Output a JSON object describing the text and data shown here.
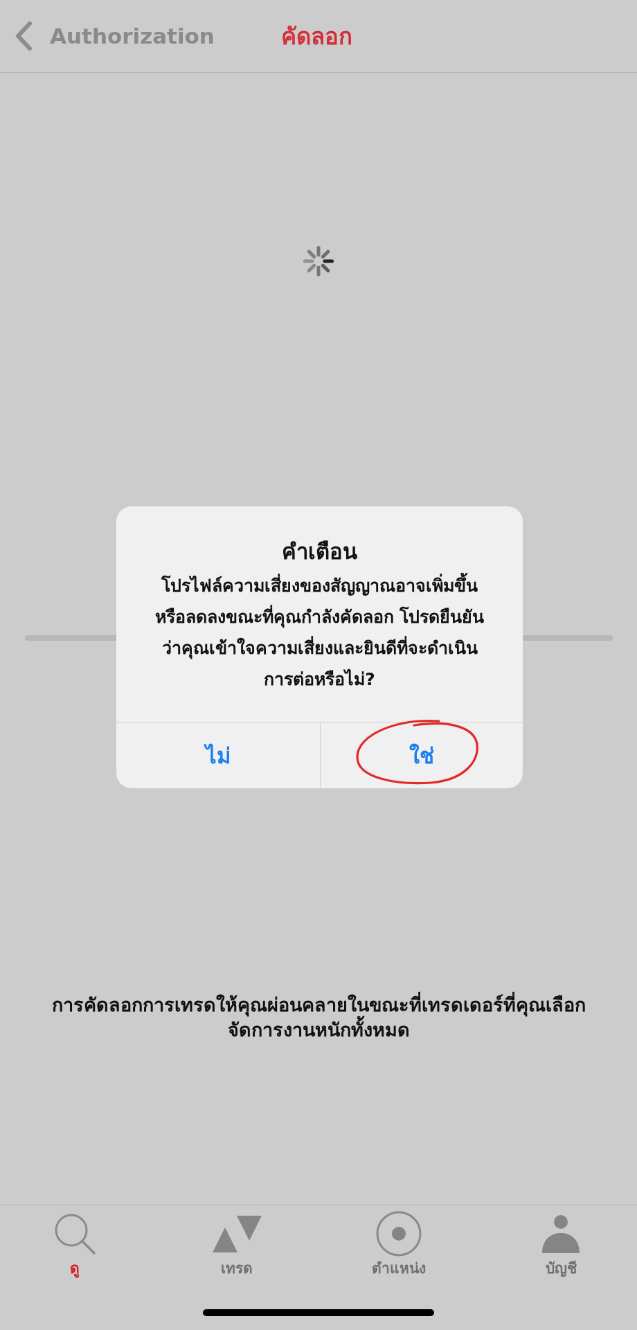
{
  "nav_bar": {
    "back_label": "Authorization",
    "title": "คัดลอก"
  },
  "alert": {
    "title": "คำเตือน",
    "message": "โปรไฟล์ความเสี่ยงของสัญญาณอาจเพิ่มขึ้น\nหรือลดลงขณะที่คุณกำลังคัดลอก โปรดยืนยัน\nว่าคุณเข้าใจความเสี่ยงและยินดีที่จะดำเนิน\nการต่อหรือไม่?",
    "buttons": [
      {
        "label": "ไม่",
        "circled": false
      },
      {
        "label": "ใช่",
        "circled": true
      }
    ]
  },
  "description": "การคัดลอกการเทรดให้คุณผ่อนคลายในขณะที่เทรดเดอร์ที่คุณเลือก\nจัดการงานหนักทั้งหมด",
  "tabs": [
    {
      "label": "ดู",
      "selected": true
    },
    {
      "label": "เทรด",
      "selected": false
    },
    {
      "label": "ตำแหน่ง",
      "selected": false
    },
    {
      "label": "บัญชี",
      "selected": false
    }
  ]
}
